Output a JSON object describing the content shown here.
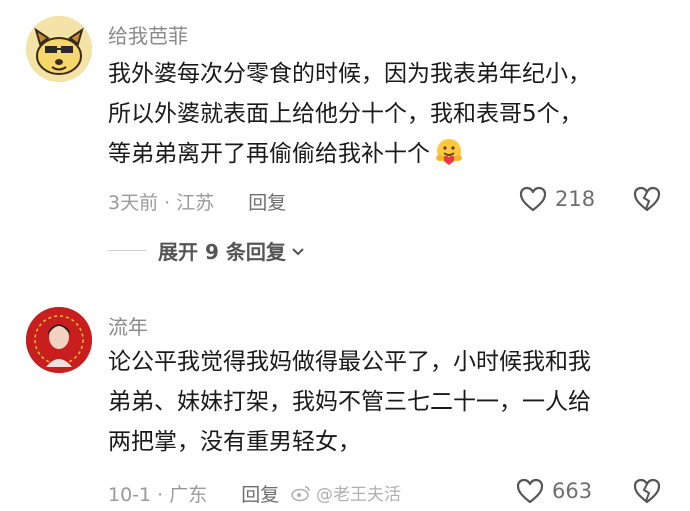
{
  "comments": [
    {
      "username": "给我芭菲",
      "lines": [
        "我外婆每次分零食的时候，因为我表弟年纪小，",
        "所以外婆就表面上给他分十个，我和表哥5个，",
        "等弟弟离开了再偷偷给我补十个"
      ],
      "time_location": "3天前 · 江苏",
      "reply_label": "回复",
      "likes": "218",
      "expand_label": "展开 9 条回复"
    },
    {
      "username": "流年",
      "lines": [
        "论公平我觉得我妈做得最公平了，小时候我和我",
        "弟弟、妹妹打架，我妈不管三七二十一，一人给",
        "两把掌，没有重男轻女，"
      ],
      "time_location": "10-1 · 广东",
      "reply_label": "回复",
      "likes": "663"
    }
  ],
  "watermark": "@老王夫活",
  "colors": {
    "text": "#1a1a1a",
    "muted": "#9a9a9a",
    "username": "#8a8a8a",
    "avatar2_bg": "#c81e1e"
  }
}
